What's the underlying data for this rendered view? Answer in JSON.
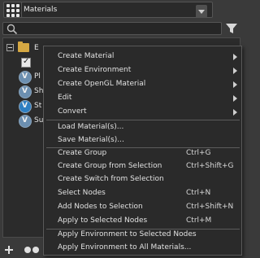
{
  "header": {
    "library_select_value": "Materials"
  },
  "search": {
    "placeholder": ""
  },
  "tree": {
    "rows": [
      {
        "label": "E",
        "type": "environment-group"
      },
      {
        "label": "",
        "type": "checked-item"
      },
      {
        "label": "Pl",
        "type": "material"
      },
      {
        "label": "Sh",
        "type": "material"
      },
      {
        "label": "St",
        "type": "material"
      },
      {
        "label": "Su",
        "type": "material"
      }
    ]
  },
  "context_menu": {
    "items": [
      {
        "label": "Create Material",
        "shortcut": "",
        "submenu": true
      },
      {
        "label": "Create Environment",
        "shortcut": "",
        "submenu": true
      },
      {
        "label": "Create OpenGL Material",
        "shortcut": "",
        "submenu": true
      },
      {
        "label": "Edit",
        "shortcut": "",
        "submenu": true
      },
      {
        "label": "Convert",
        "shortcut": "",
        "submenu": true
      },
      {
        "label": "Load Material(s)...",
        "shortcut": "",
        "submenu": false
      },
      {
        "label": "Save Material(s)...",
        "shortcut": "",
        "submenu": false
      },
      {
        "label": "Create Group",
        "shortcut": "Ctrl+G",
        "submenu": false
      },
      {
        "label": "Create Group from Selection",
        "shortcut": "Ctrl+Shift+G",
        "submenu": false
      },
      {
        "label": "Create Switch from Selection",
        "shortcut": "",
        "submenu": false
      },
      {
        "label": "Select Nodes",
        "shortcut": "Ctrl+N",
        "submenu": false
      },
      {
        "label": "Add Nodes to Selection",
        "shortcut": "Ctrl+Shift+N",
        "submenu": false
      },
      {
        "label": "Apply to Selected Nodes",
        "shortcut": "Ctrl+M",
        "submenu": false
      },
      {
        "label": "Apply Environment to Selected Nodes",
        "shortcut": "",
        "submenu": false
      },
      {
        "label": "Apply Environment to All Materials...",
        "shortcut": "",
        "submenu": false
      }
    ]
  },
  "colors": {
    "background": "#3a3a3a",
    "menu_background": "#2a2a2a",
    "folder": "#d5a843",
    "material_icon": "#6c8fb0",
    "selected_material_icon": "#2e7fc2"
  }
}
